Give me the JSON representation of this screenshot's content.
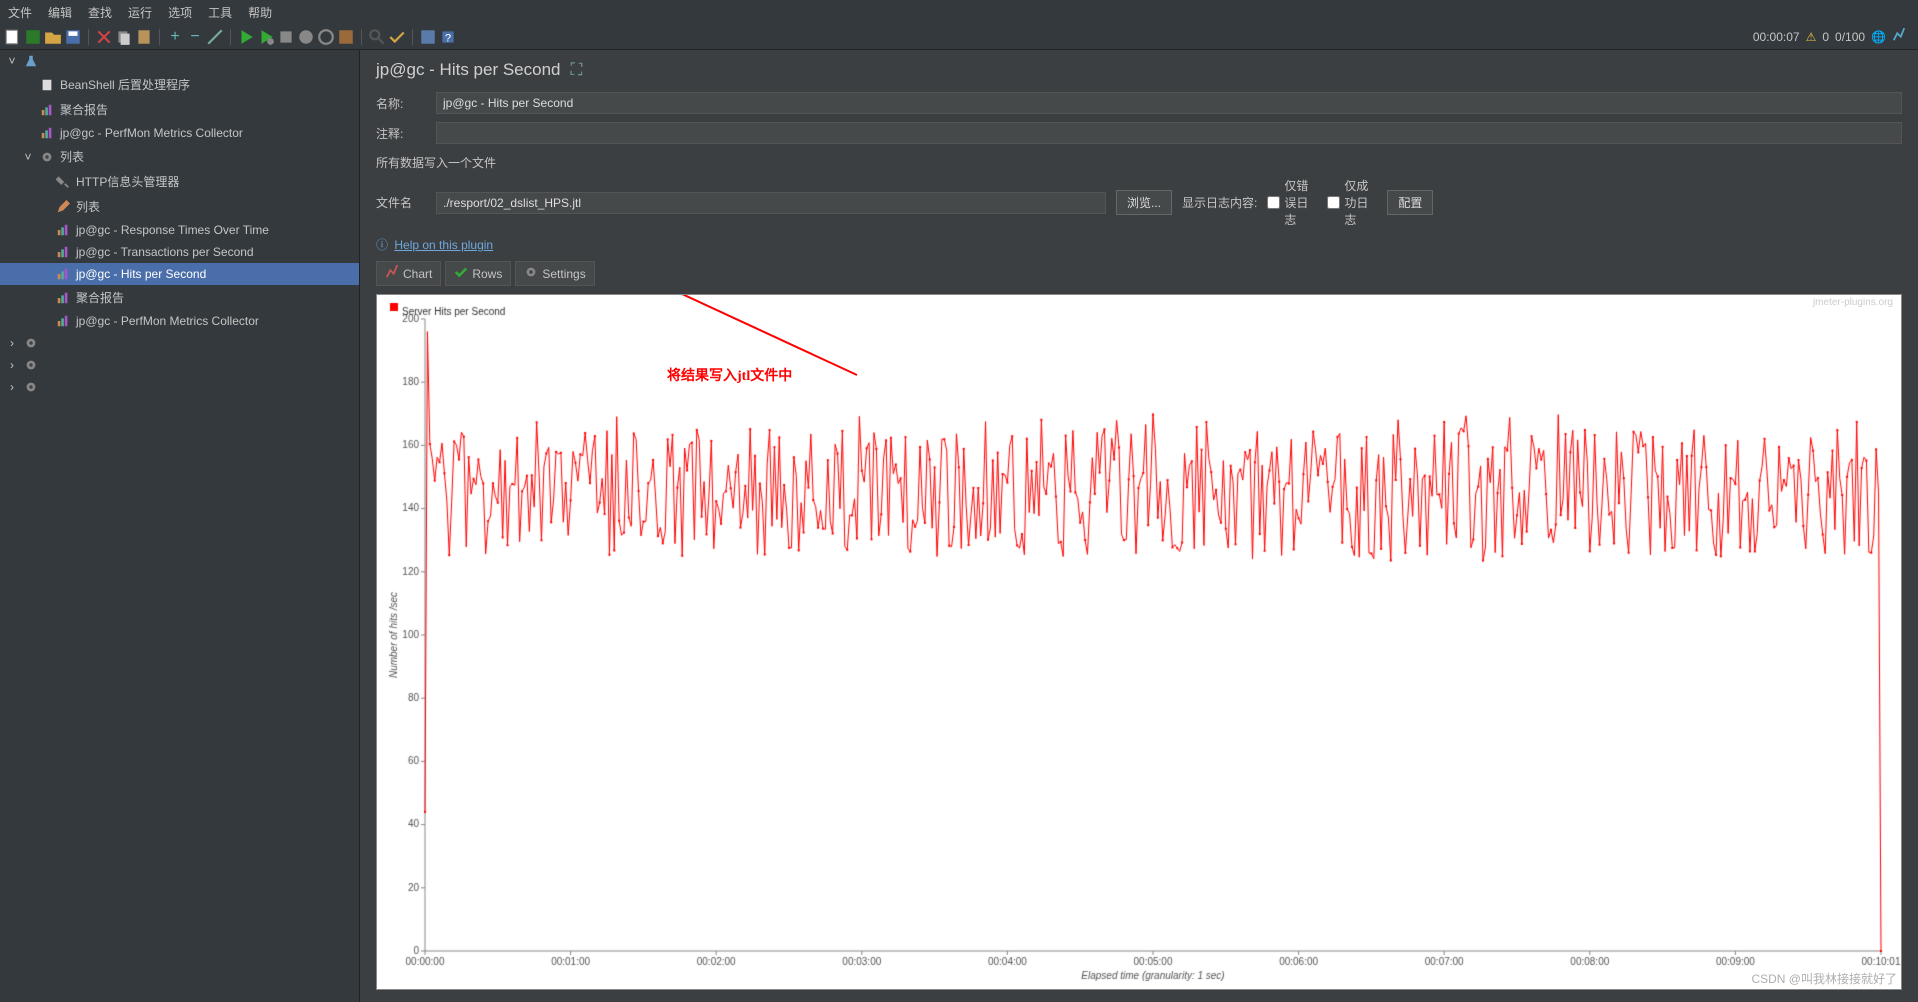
{
  "menubar": [
    "文件",
    "编辑",
    "查找",
    "运行",
    "选项",
    "工具",
    "帮助"
  ],
  "toolbar_right": {
    "timer": "00:00:07",
    "warn": "0",
    "threads": "0/100"
  },
  "tree": [
    {
      "indent": 0,
      "expander": "˅",
      "icon": "flask",
      "label": ""
    },
    {
      "indent": 1,
      "expander": "",
      "icon": "doc",
      "label": "BeanShell 后置处理程序"
    },
    {
      "indent": 1,
      "expander": "",
      "icon": "chart",
      "label": "聚合报告"
    },
    {
      "indent": 1,
      "expander": "",
      "icon": "chart",
      "label": "jp@gc - PerfMon Metrics Collector"
    },
    {
      "indent": 1,
      "expander": "˅",
      "icon": "gear",
      "label": "列表"
    },
    {
      "indent": 2,
      "expander": "",
      "icon": "wrench",
      "label": "HTTP信息头管理器"
    },
    {
      "indent": 2,
      "expander": "",
      "icon": "pencil",
      "label": "列表"
    },
    {
      "indent": 2,
      "expander": "",
      "icon": "chart",
      "label": "jp@gc - Response Times Over Time"
    },
    {
      "indent": 2,
      "expander": "",
      "icon": "chart",
      "label": "jp@gc - Transactions per Second"
    },
    {
      "indent": 2,
      "expander": "",
      "icon": "chart",
      "label": "jp@gc - Hits per Second",
      "selected": true
    },
    {
      "indent": 2,
      "expander": "",
      "icon": "chart",
      "label": "聚合报告"
    },
    {
      "indent": 2,
      "expander": "",
      "icon": "chart",
      "label": "jp@gc - PerfMon Metrics Collector"
    },
    {
      "indent": 0,
      "expander": "›",
      "icon": "gear",
      "label": ""
    },
    {
      "indent": 0,
      "expander": "›",
      "icon": "gear",
      "label": ""
    },
    {
      "indent": 0,
      "expander": "›",
      "icon": "gear",
      "label": ""
    }
  ],
  "panel": {
    "title": "jp@gc - Hits per Second",
    "name_label": "名称:",
    "name_value": "jp@gc - Hits per Second",
    "note_label": "注释:",
    "note_value": "",
    "section": "所有数据写入一个文件",
    "file_label": "文件名",
    "file_value": "./resport/02_dslist_HPS.jtl",
    "browse": "浏览...",
    "display_log": "显示日志内容:",
    "only_error": "仅错误日志",
    "only_success": "仅成功日志",
    "config": "配置",
    "help": "Help on this plugin",
    "tabs": [
      "Chart",
      "Rows",
      "Settings"
    ]
  },
  "chart_data": {
    "type": "line",
    "title": "",
    "legend": "Server Hits per Second",
    "xlabel": "Elapsed time (granularity: 1 sec)",
    "ylabel": "Number of hits /sec",
    "ylim": [
      0,
      200
    ],
    "yticks": [
      0,
      20,
      40,
      60,
      80,
      100,
      120,
      140,
      160,
      180,
      200
    ],
    "xticks": [
      "00:00:00",
      "00:01:00",
      "00:02:00",
      "00:03:00",
      "00:04:00",
      "00:05:00",
      "00:06:00",
      "00:07:00",
      "00:08:00",
      "00:09:00",
      "00:10:01"
    ],
    "watermark": "jmeter-plugins.org",
    "annotation": "将结果写入jtl文件中",
    "csdn": "CSDN @叫我林接接就好了",
    "series": [
      {
        "name": "Server Hits per Second",
        "color": "#ff0000",
        "start_value": 44,
        "spike_value": 196,
        "end_value": 0,
        "mean": 145,
        "jitter_min": 128,
        "jitter_max": 165,
        "duration_sec": 601,
        "n_points": 601
      }
    ]
  }
}
